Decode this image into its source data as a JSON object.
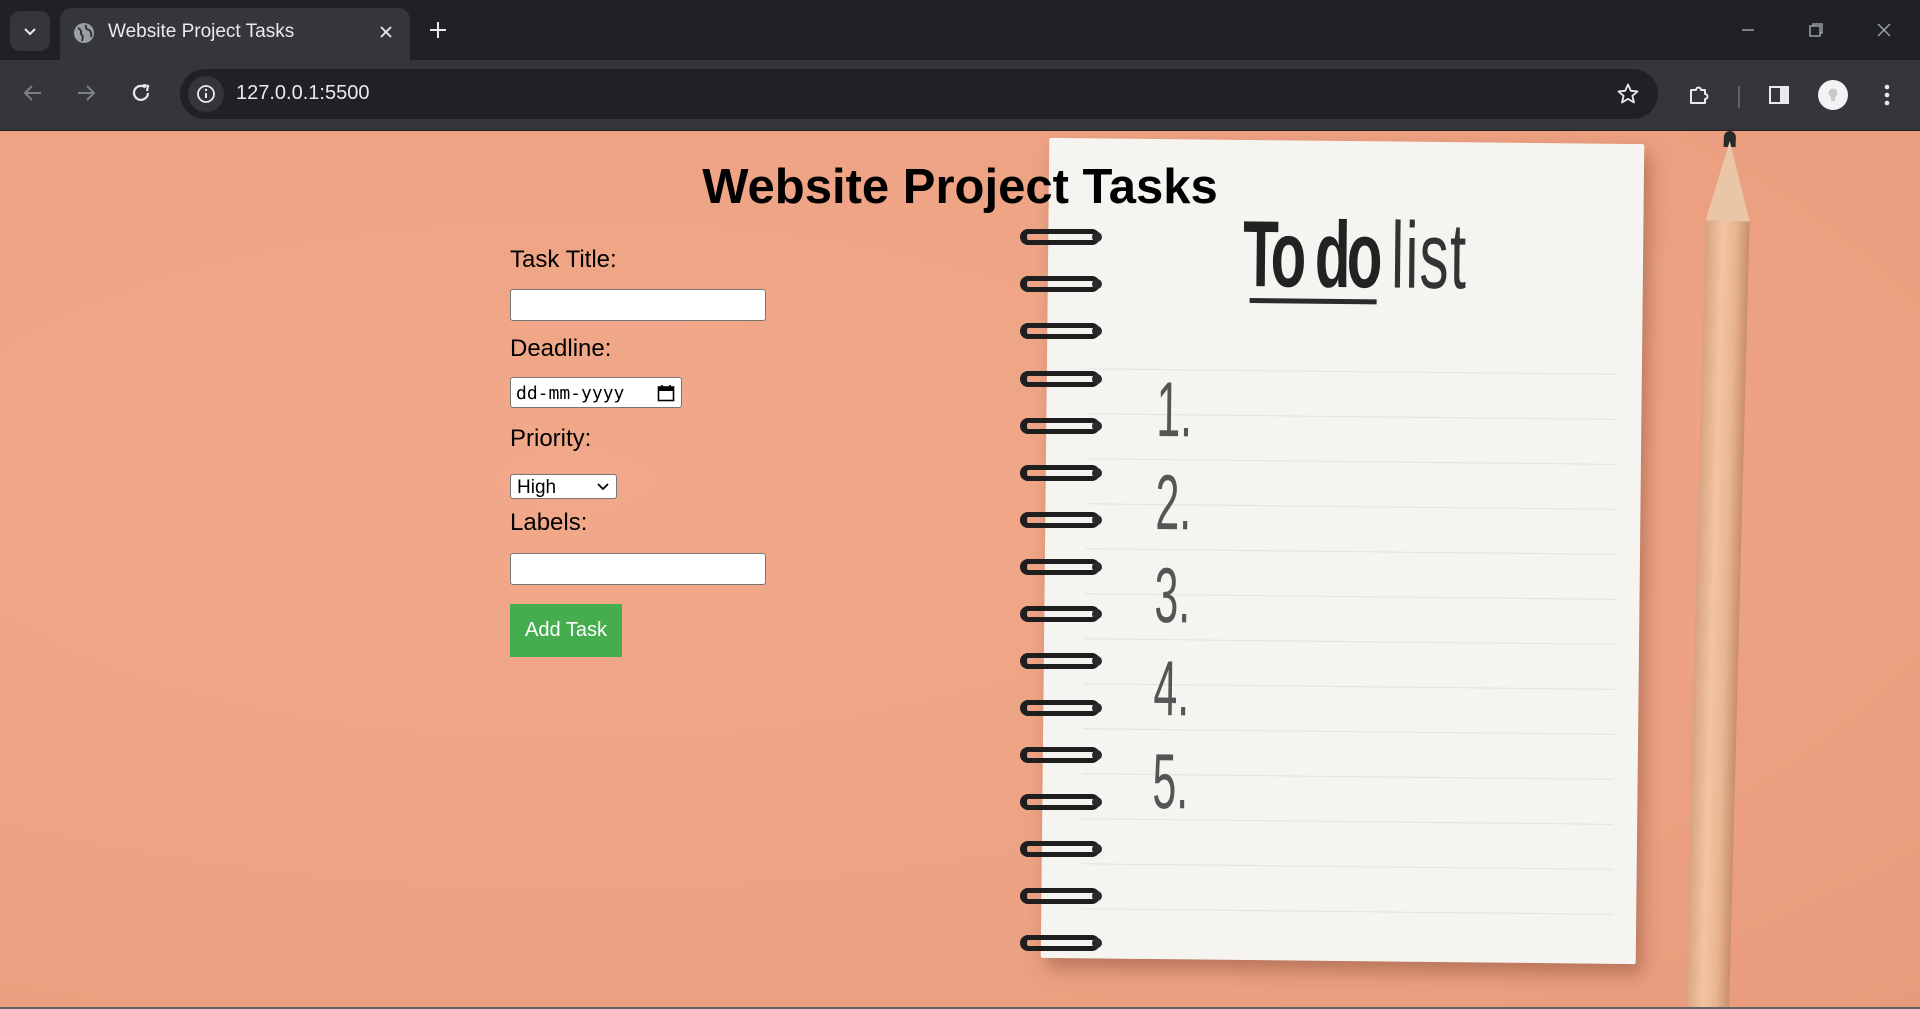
{
  "browser": {
    "tab_title": "Website Project Tasks",
    "url": "127.0.0.1:5500"
  },
  "page": {
    "title": "Website Project Tasks",
    "form": {
      "task_title_label": "Task Title:",
      "task_title_value": "",
      "deadline_label": "Deadline:",
      "deadline_placeholder": "dd-mm-yyyy",
      "priority_label": "Priority:",
      "priority_value": "High",
      "labels_label": "Labels:",
      "labels_value": "",
      "add_button": "Add Task"
    },
    "illustration": {
      "heading_bold": "To do",
      "heading_thin": "list",
      "numbers": [
        "1.",
        "2.",
        "3.",
        "4.",
        "5."
      ]
    }
  },
  "colors": {
    "background": "#eda283",
    "button": "#45ad4e",
    "chrome_dark": "#202124",
    "chrome_toolbar": "#35363a"
  }
}
